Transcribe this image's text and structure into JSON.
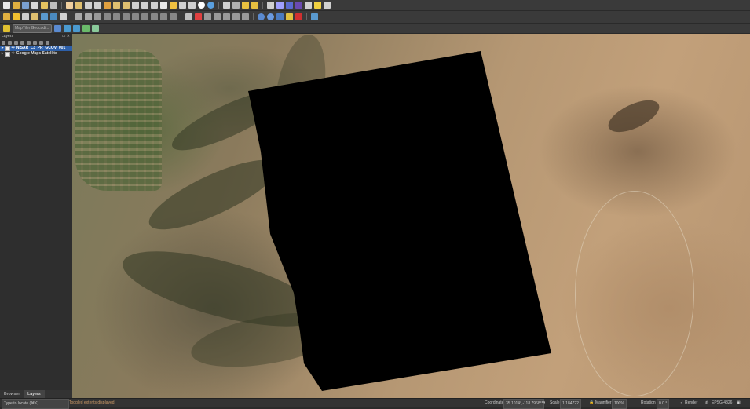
{
  "toolbar": {
    "geocoder_placeholder": "MapTiler Geocodi..."
  },
  "layers_panel": {
    "title": "Layers",
    "layers": [
      {
        "name": "NISAR_L3_PR_GCOV_001",
        "selected": true,
        "checked": true
      },
      {
        "name": "Google Maps Satellite",
        "selected": false,
        "checked": true
      }
    ]
  },
  "panel_tabs": [
    "Browser",
    "Layers"
  ],
  "status_bar": {
    "locate_placeholder": "Type to locate (⌘K)",
    "message": "Toggled extents displayed",
    "coordinate_label": "Coordinate",
    "coordinate_value": "35.1014°,-118.7968°",
    "scale_label": "Scale",
    "scale_value": "1:184722",
    "magnifier_label": "Magnifier",
    "magnifier_value": "100%",
    "rotation_label": "Rotation",
    "rotation_value": "0.0 °",
    "render_label": "Render",
    "crs_label": "EPSG:4326"
  },
  "colors": {
    "selection": "#2d5fa8",
    "raster_fill": "#000000"
  }
}
